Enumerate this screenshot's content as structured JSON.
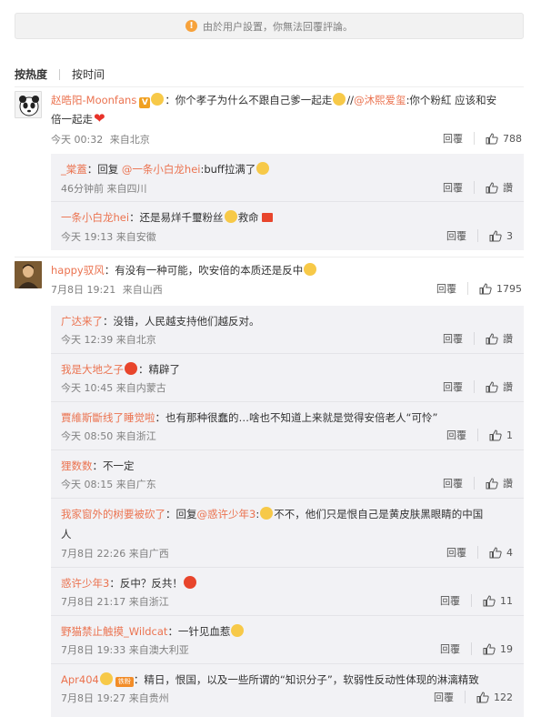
{
  "notice": {
    "text": "由於用户設置，你無法回覆評論。",
    "icon": "warning-icon"
  },
  "tabs": [
    {
      "label": "按热度",
      "active": true
    },
    {
      "label": "按时间",
      "active": false
    }
  ],
  "comments": [
    {
      "name": "赵晧阳-Moonfans",
      "text_a": "：你个孝子为什么不跟自己爹一起走",
      "mention": "@沐熙爱玺",
      "text_b": ":你个粉紅 应该和安",
      "text_c": "倍一起走",
      "time": "今天 00:32",
      "location": "来自北京",
      "reply_label": "回覆",
      "likes": "788",
      "replies": [
        {
          "name": "_棠蓋",
          "prefix": "：回复 ",
          "mention": "@一条小白龙hei",
          "text": ":buff拉满了",
          "time": "46分钟前",
          "location": "来自四川",
          "reply_label": "回覆",
          "likes": "讚"
        },
        {
          "name": "一条小白龙hei",
          "prefix": "",
          "mention": "",
          "text": "：还是易烊千璽粉丝",
          "text_after": "救命",
          "time": "今天 19:13",
          "location": "来自安徽",
          "reply_label": "回覆",
          "likes": "3"
        }
      ]
    },
    {
      "name": "happy驭风",
      "text_a": "：有没有一种可能，吹安倍的本质还是反中",
      "time": "7月8日 19:21",
      "location": "来自山西",
      "reply_label": "回覆",
      "likes": "1795",
      "replies": [
        {
          "name": "广达来了",
          "text": "：没错，人民越支持他们越反对。",
          "time": "今天 12:39",
          "location": "来自北京",
          "reply_label": "回覆",
          "likes": "讚"
        },
        {
          "name": "我是大地之子",
          "text": "：精辟了",
          "time": "今天 10:45",
          "location": "来自内蒙古",
          "reply_label": "回覆",
          "likes": "讚"
        },
        {
          "name": "賈維斯斷线了睡觉啦",
          "text": "：也有那种很蠢的…啥也不知道上来就是觉得安倍老人“可怜”",
          "time": "今天 08:50",
          "location": "来自浙江",
          "reply_label": "回覆",
          "likes": "1"
        },
        {
          "name": "狸数数",
          "text": "：不一定",
          "time": "今天 08:15",
          "location": "来自广东",
          "reply_label": "回覆",
          "likes": "讚"
        },
        {
          "name": "我家窗外的树要被砍了",
          "prefix": "：回复",
          "mention": "@惑许少年3",
          "text": ":",
          "text_after": "不不，他们只是恨自己是黄皮肤黑眼睛的中国",
          "text_line2": "人",
          "time": "7月8日 22:26",
          "location": "来自广西",
          "reply_label": "回覆",
          "likes": "4"
        },
        {
          "name": "惑许少年3",
          "text": "：反中？反共！",
          "time": "7月8日 21:17",
          "location": "来自浙江",
          "reply_label": "回覆",
          "likes": "11"
        },
        {
          "name": "野猫禁止触摸_Wildcat",
          "text": "：一针见血惹",
          "time": "7月8日 19:33",
          "location": "来自澳大利亚",
          "reply_label": "回覆",
          "likes": "19"
        },
        {
          "name": "Apr404",
          "badge": "铁粉",
          "text": "：精日，恨国，以及一些所谓的“知识分子”，软弱性反动性体现的淋漓精致",
          "time": "7月8日 19:27",
          "location": "来自贵州",
          "reply_label": "回覆",
          "likes": "122"
        }
      ]
    }
  ],
  "icons": {
    "like": "thumbs-up-icon",
    "warning": "warning-icon",
    "emoji": "emoji-icon"
  },
  "colors": {
    "username": "#eb7350",
    "meta": "#808080",
    "subbox": "#f2f2f5",
    "notice_bg": "#f2f2f2",
    "warning": "#f7a23b"
  }
}
